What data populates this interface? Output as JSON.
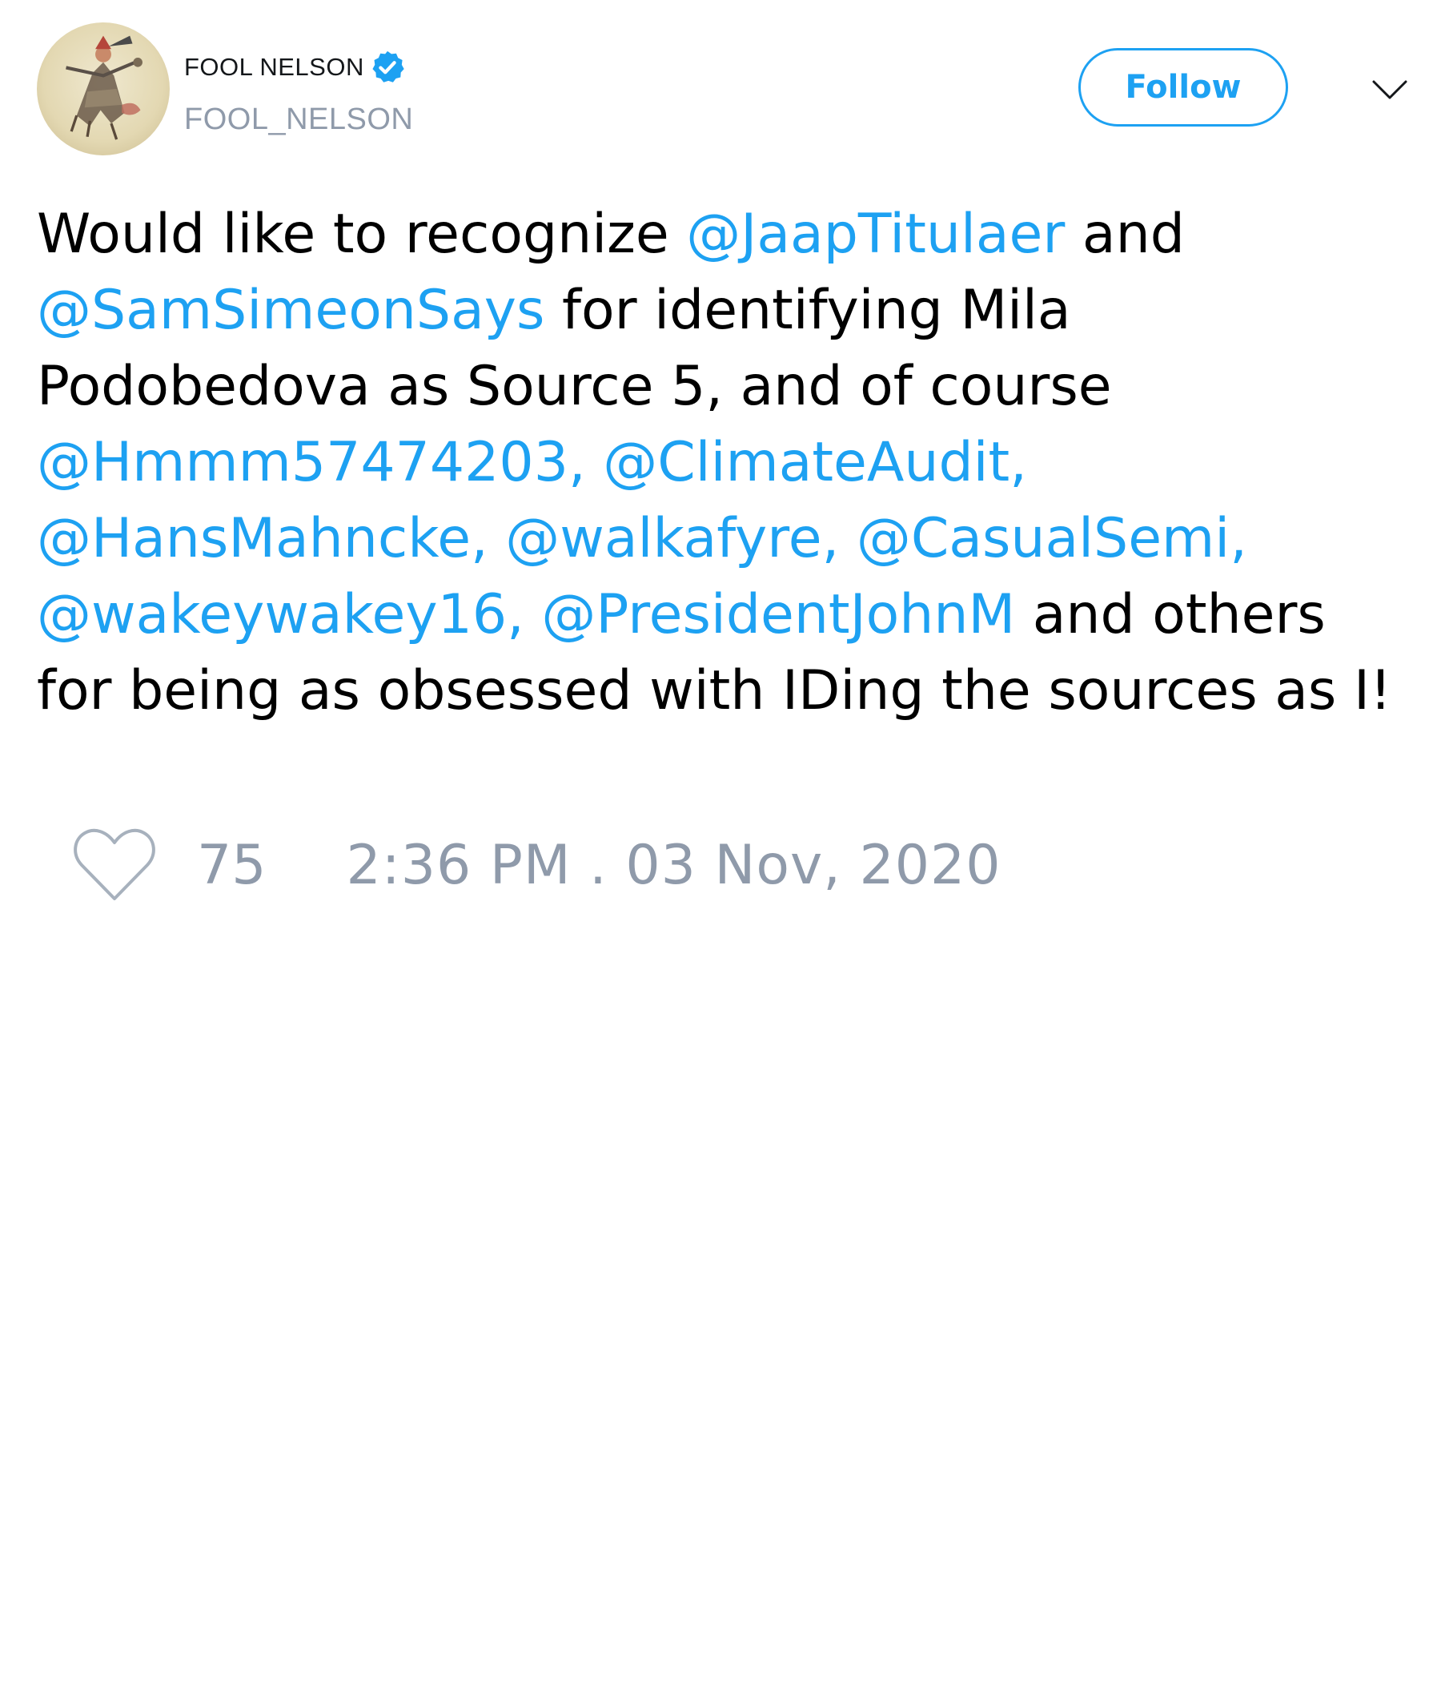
{
  "author": {
    "display_name": "FOOL NELSON",
    "handle": "FOOL_NELSON",
    "verified": true,
    "avatar_icon": "jester-illustration-avatar"
  },
  "header": {
    "follow_label": "Follow",
    "menu_icon": "chevron-down-icon"
  },
  "tweet": {
    "lines": [
      [
        {
          "text": "Would like to recognize ",
          "mention": false
        },
        {
          "text": "@JaapTitulaer",
          "mention": true
        },
        {
          "text": " and",
          "mention": false
        }
      ],
      [
        {
          "text": "@SamSimeonSays",
          "mention": true
        },
        {
          "text": " for identifying Mila",
          "mention": false
        }
      ],
      [
        {
          "text": "Podobedova as Source 5, and of course",
          "mention": false
        }
      ],
      [
        {
          "text": "@Hmmm57474203, @ClimateAudit,",
          "mention": true
        }
      ],
      [
        {
          "text": "@HansMahncke, @walkafyre, @CasualSemi,",
          "mention": true
        }
      ],
      [
        {
          "text": "@wakeywakey16, @PresidentJohnM",
          "mention": true
        },
        {
          "text": " and others",
          "mention": false
        }
      ],
      [
        {
          "text": "for being as obsessed with IDing the sources as I!",
          "mention": false
        }
      ]
    ]
  },
  "footer": {
    "like_icon": "heart-icon",
    "like_count": "75",
    "timestamp": "2:36 PM . 03 Nov, 2020"
  },
  "colors": {
    "accent": "#1da1f2",
    "muted": "#8f9aaa",
    "text": "#000000",
    "background": "#ffffff"
  }
}
